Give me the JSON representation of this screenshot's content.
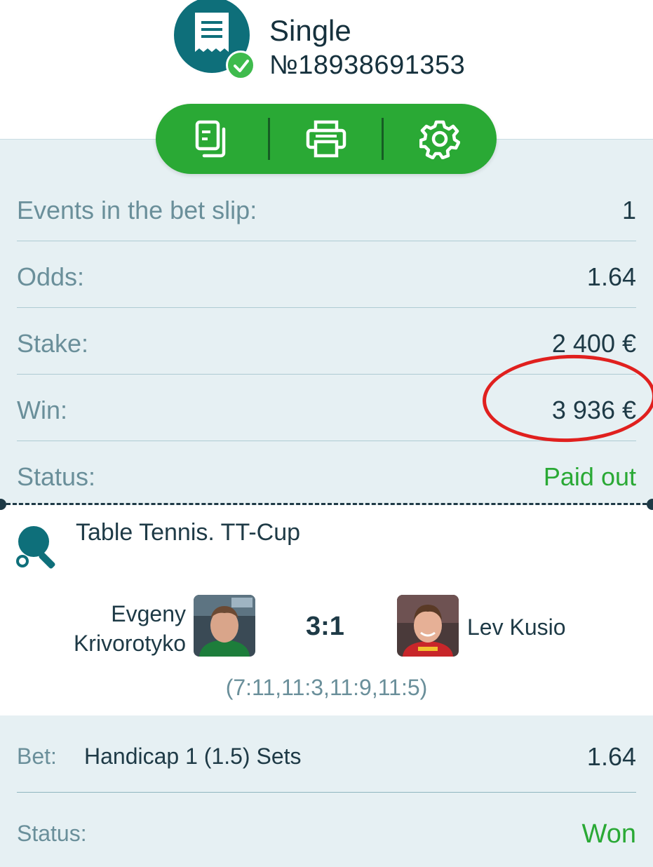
{
  "header": {
    "bet_type": "Single",
    "bet_number": "№18938691353"
  },
  "toolbar": {
    "icons": [
      "copy-icon",
      "print-icon",
      "settings-icon"
    ]
  },
  "summary": {
    "events_label": "Events in the bet slip:",
    "events_value": "1",
    "odds_label": "Odds:",
    "odds_value": "1.64",
    "stake_label": "Stake:",
    "stake_value": "2 400 €",
    "win_label": "Win:",
    "win_value": "3 936 €",
    "status_label": "Status:",
    "status_value": "Paid out"
  },
  "event": {
    "title": "Table Tennis. TT-Cup",
    "player1_first": "Evgeny",
    "player1_last": "Krivorotyko",
    "player2": "Lev Kusio",
    "score": "3:1",
    "set_scores": "(7:11,11:3,11:9,11:5)"
  },
  "bet": {
    "bet_label": "Bet:",
    "market": "Handicap 1 (1.5) Sets",
    "odds": "1.64",
    "status_label": "Status:",
    "status_value": "Won"
  },
  "colors": {
    "brand_teal": "#0e6f7a",
    "accent_green": "#2aa935",
    "panel_bg": "#e6f0f3",
    "highlight_red": "#e0201e"
  }
}
